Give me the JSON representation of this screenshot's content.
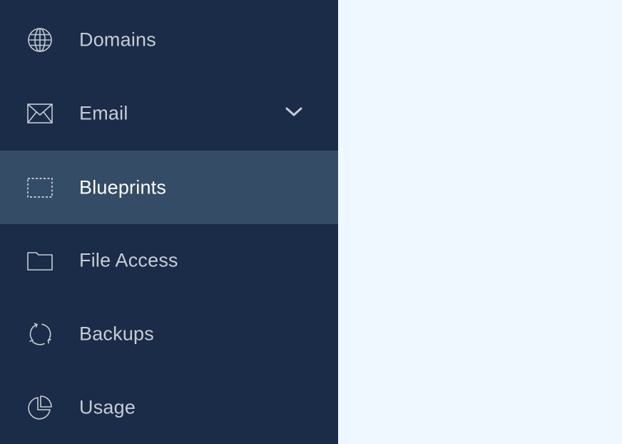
{
  "sidebar": {
    "items": [
      {
        "label": "Domains",
        "icon": "globe-icon"
      },
      {
        "label": "Email",
        "icon": "envelope-icon",
        "has_submenu": true
      },
      {
        "label": "Blueprints",
        "icon": "dashed-square-icon",
        "active": true
      },
      {
        "label": "File Access",
        "icon": "folder-icon"
      },
      {
        "label": "Backups",
        "icon": "refresh-icon"
      },
      {
        "label": "Usage",
        "icon": "pie-chart-icon"
      }
    ]
  },
  "colors": {
    "sidebar_bg": "#1a2c47",
    "active_item_bg": "#354c67",
    "label_text": "#c5ccd6",
    "active_label_text": "#ffffff",
    "content_bg": "#eff8fe"
  }
}
